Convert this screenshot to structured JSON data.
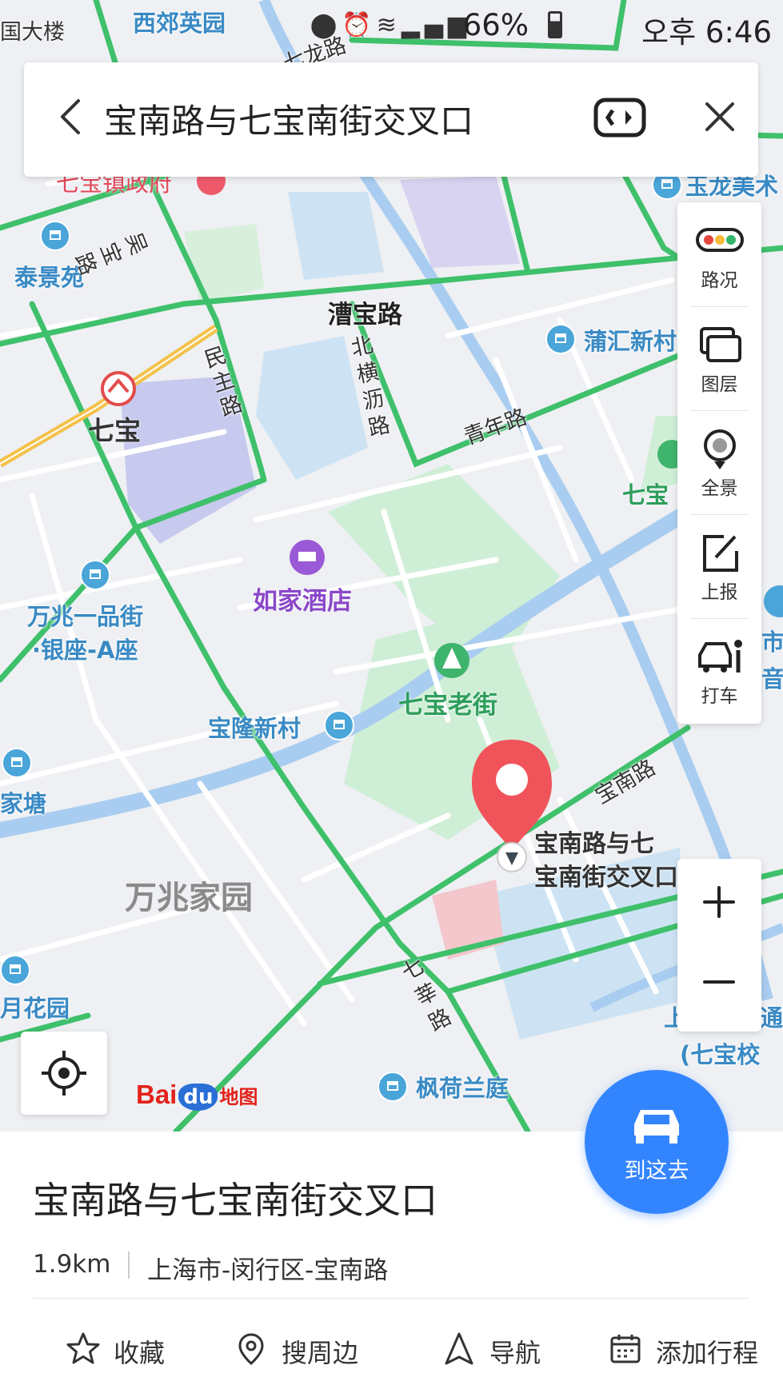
{
  "status_bar": {
    "battery": "66%",
    "clock": "오후 6:46"
  },
  "search": {
    "query": "宝南路与七宝南街交叉口"
  },
  "map": {
    "labels": {
      "top_left_building": "国大楼",
      "xijiao": "西郊英园",
      "top_road": "七龙路",
      "qibao_gov": "七宝镇政府",
      "yulong": "玉龙美术",
      "taijing": "泰景苑",
      "wubao_rd": "吴宝路",
      "caobao_rd": "漕宝路",
      "puhui": "蒲汇新村",
      "minzhu_rd": "民主路",
      "beihengli_rd": "北横沥路",
      "qingnian_rd": "青年路",
      "qibao_metro": "七宝",
      "qibao_park": "七宝",
      "rujia": "如家酒店",
      "wanzhao_line1": "万兆一品街",
      "wanzhao_line2": "·银座-A座",
      "qibao_oldstreet": "七宝老街",
      "baolong": "宝隆新村",
      "jiatang": "家塘",
      "baonan_rd": "宝南路",
      "pin_line1": "宝南路与七",
      "pin_line2": "宝南街交叉口",
      "wanzhao_garden": "万兆家园",
      "qixin_rd": "七莘路",
      "yuehuayuan": "月花园",
      "fenghe": "枫荷兰庭",
      "right_edge_1": "市",
      "right_edge_2": "音",
      "school_line1": "上",
      "school_line2": "(七宝校",
      "school_extra": "通"
    }
  },
  "tools": [
    {
      "label": "路况",
      "icon": "traffic-light-icon"
    },
    {
      "label": "图层",
      "icon": "layers-icon"
    },
    {
      "label": "全景",
      "icon": "panorama-icon"
    },
    {
      "label": "上报",
      "icon": "report-edit-icon"
    },
    {
      "label": "打车",
      "icon": "taxi-icon"
    }
  ],
  "zoom": {
    "in": "+",
    "out": "−"
  },
  "logo": {
    "bai": "Bai",
    "du": "du",
    "ditu": "地图"
  },
  "go_button": {
    "label": "到这去"
  },
  "place": {
    "title": "宝南路与七宝南街交叉口",
    "distance": "1.9km",
    "address": "上海市-闵行区-宝南路"
  },
  "actions": [
    {
      "label": "收藏",
      "icon": "star-icon"
    },
    {
      "label": "搜周边",
      "icon": "location-pin-icon"
    },
    {
      "label": "导航",
      "icon": "navigation-arrow-icon"
    },
    {
      "label": "添加行程",
      "icon": "calendar-icon"
    }
  ],
  "colors": {
    "primary_blue": "#3385ff",
    "road_green": "#3fc06b",
    "pin_red": "#f0545a",
    "water_blue": "#a9cdf0",
    "park_green": "#c9ecd0"
  }
}
